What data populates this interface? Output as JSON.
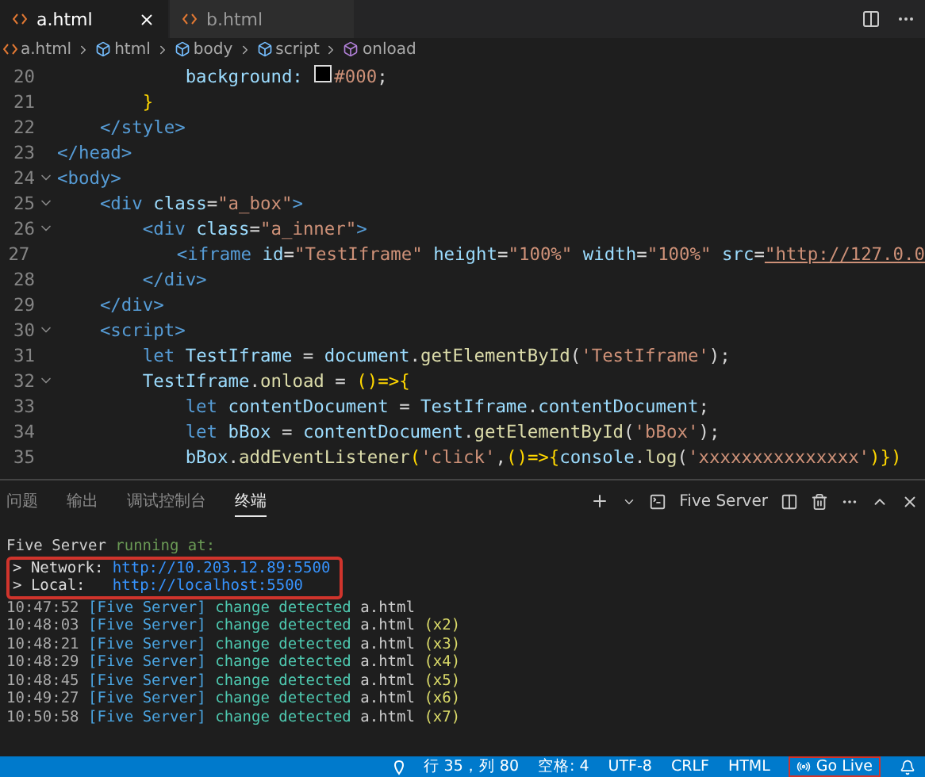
{
  "tabs": [
    {
      "label": "a.html",
      "selected": true
    },
    {
      "label": "b.html",
      "selected": false
    }
  ],
  "breadcrumb": [
    {
      "label": "a.html",
      "kind": "file"
    },
    {
      "label": "html",
      "kind": "element"
    },
    {
      "label": "body",
      "kind": "element"
    },
    {
      "label": "script",
      "kind": "element"
    },
    {
      "label": "onload",
      "kind": "method"
    }
  ],
  "code_lines": [
    {
      "number": "20",
      "foldable": false,
      "tokens": [
        {
          "text": "            background: ",
          "kind": "attr"
        },
        {
          "text": "#000",
          "kind": "swatch"
        },
        {
          "text": ";",
          "kind": "plain"
        }
      ]
    },
    {
      "number": "21",
      "foldable": false,
      "tokens": [
        {
          "text": "        }",
          "kind": "brace"
        }
      ]
    },
    {
      "number": "22",
      "foldable": false,
      "tokens": [
        {
          "text": "    </style>",
          "kind": "tag"
        }
      ]
    },
    {
      "number": "23",
      "foldable": false,
      "tokens": [
        {
          "text": "</head>",
          "kind": "tag"
        }
      ]
    },
    {
      "number": "24",
      "foldable": true,
      "tokens": [
        {
          "text": "<body>",
          "kind": "tag"
        }
      ]
    },
    {
      "number": "25",
      "foldable": true,
      "tokens": [
        {
          "text": "    <div ",
          "kind": "tag"
        },
        {
          "text": "class",
          "kind": "attr"
        },
        {
          "text": "=",
          "kind": "plain"
        },
        {
          "text": "\"a_box\"",
          "kind": "string"
        },
        {
          "text": ">",
          "kind": "tag"
        }
      ]
    },
    {
      "number": "26",
      "foldable": true,
      "tokens": [
        {
          "text": "        <div ",
          "kind": "tag"
        },
        {
          "text": "class",
          "kind": "attr"
        },
        {
          "text": "=",
          "kind": "plain"
        },
        {
          "text": "\"a_inner\"",
          "kind": "string"
        },
        {
          "text": ">",
          "kind": "tag"
        }
      ]
    },
    {
      "number": "27",
      "foldable": false,
      "tokens": [
        {
          "text": "            <iframe ",
          "kind": "tag"
        },
        {
          "text": "id",
          "kind": "attr"
        },
        {
          "text": "=",
          "kind": "plain"
        },
        {
          "text": "\"TestIframe\" ",
          "kind": "string"
        },
        {
          "text": "height",
          "kind": "attr"
        },
        {
          "text": "=",
          "kind": "plain"
        },
        {
          "text": "\"100%\" ",
          "kind": "string"
        },
        {
          "text": "width",
          "kind": "attr"
        },
        {
          "text": "=",
          "kind": "plain"
        },
        {
          "text": "\"100%\" ",
          "kind": "string"
        },
        {
          "text": "src",
          "kind": "attr"
        },
        {
          "text": "=",
          "kind": "plain"
        },
        {
          "text": "\"http://127.0.0",
          "kind": "link"
        }
      ]
    },
    {
      "number": "28",
      "foldable": false,
      "tokens": [
        {
          "text": "        </div>",
          "kind": "tag"
        }
      ]
    },
    {
      "number": "29",
      "foldable": false,
      "tokens": [
        {
          "text": "    </div>",
          "kind": "tag"
        }
      ]
    },
    {
      "number": "30",
      "foldable": true,
      "tokens": [
        {
          "text": "    <script>",
          "kind": "tag"
        }
      ]
    },
    {
      "number": "31",
      "foldable": false,
      "tokens": [
        {
          "text": "        let ",
          "kind": "keyword"
        },
        {
          "text": "TestIframe",
          "kind": "attr"
        },
        {
          "text": " = ",
          "kind": "plain"
        },
        {
          "text": "document",
          "kind": "attr"
        },
        {
          "text": ".",
          "kind": "plain"
        },
        {
          "text": "getElementById",
          "kind": "func"
        },
        {
          "text": "(",
          "kind": "plain"
        },
        {
          "text": "'TestIframe'",
          "kind": "string"
        },
        {
          "text": ");",
          "kind": "plain"
        }
      ]
    },
    {
      "number": "32",
      "foldable": true,
      "tokens": [
        {
          "text": "        TestIframe",
          "kind": "attr"
        },
        {
          "text": ".",
          "kind": "plain"
        },
        {
          "text": "onload",
          "kind": "func"
        },
        {
          "text": " = ",
          "kind": "plain"
        },
        {
          "text": "()=>{",
          "kind": "brace"
        }
      ]
    },
    {
      "number": "33",
      "foldable": false,
      "tokens": [
        {
          "text": "            let ",
          "kind": "keyword"
        },
        {
          "text": "contentDocument",
          "kind": "attr"
        },
        {
          "text": " = ",
          "kind": "plain"
        },
        {
          "text": "TestIframe",
          "kind": "attr"
        },
        {
          "text": ".",
          "kind": "plain"
        },
        {
          "text": "contentDocument",
          "kind": "attr"
        },
        {
          "text": ";",
          "kind": "plain"
        }
      ]
    },
    {
      "number": "34",
      "foldable": false,
      "tokens": [
        {
          "text": "            let ",
          "kind": "keyword"
        },
        {
          "text": "bBox",
          "kind": "attr"
        },
        {
          "text": " = ",
          "kind": "plain"
        },
        {
          "text": "contentDocument",
          "kind": "attr"
        },
        {
          "text": ".",
          "kind": "plain"
        },
        {
          "text": "getElementById",
          "kind": "func"
        },
        {
          "text": "(",
          "kind": "plain"
        },
        {
          "text": "'bBox'",
          "kind": "string"
        },
        {
          "text": ");",
          "kind": "plain"
        }
      ]
    },
    {
      "number": "35",
      "foldable": false,
      "tokens": [
        {
          "text": "            bBox",
          "kind": "attr"
        },
        {
          "text": ".",
          "kind": "plain"
        },
        {
          "text": "addEventListener",
          "kind": "func"
        },
        {
          "text": "(",
          "kind": "brace"
        },
        {
          "text": "'click'",
          "kind": "string"
        },
        {
          "text": ",",
          "kind": "plain"
        },
        {
          "text": "()=>{",
          "kind": "brace"
        },
        {
          "text": "console",
          "kind": "attr"
        },
        {
          "text": ".",
          "kind": "plain"
        },
        {
          "text": "log",
          "kind": "func"
        },
        {
          "text": "(",
          "kind": "plain"
        },
        {
          "text": "'xxxxxxxxxxxxxxx'",
          "kind": "string"
        },
        {
          "text": ")})",
          "kind": "brace"
        }
      ]
    }
  ],
  "panel": {
    "tabs": [
      {
        "label": "问题",
        "selected": false
      },
      {
        "label": "输出",
        "selected": false
      },
      {
        "label": "调试控制台",
        "selected": false
      },
      {
        "label": "终端",
        "selected": true
      }
    ],
    "terminal_name": "Five Server",
    "header": [
      {
        "text": "Five Server ",
        "kind": "plain"
      },
      {
        "text": "running at:",
        "kind": "dim"
      }
    ],
    "addresses": [
      {
        "label": "> Network:",
        "url": "http://10.203.12.89:5500"
      },
      {
        "label": "> Local:",
        "url": "http://localhost:5500"
      }
    ],
    "log": [
      {
        "time": "10:47:52",
        "source": "[Five Server]",
        "message": "change detected",
        "file": "a.html"
      },
      {
        "time": "10:48:03",
        "source": "[Five Server]",
        "message": "change detected",
        "file": "a.html",
        "count": "(x2)"
      },
      {
        "time": "10:48:21",
        "source": "[Five Server]",
        "message": "change detected",
        "file": "a.html",
        "count": "(x3)"
      },
      {
        "time": "10:48:29",
        "source": "[Five Server]",
        "message": "change detected",
        "file": "a.html",
        "count": "(x4)"
      },
      {
        "time": "10:48:45",
        "source": "[Five Server]",
        "message": "change detected",
        "file": "a.html",
        "count": "(x5)"
      },
      {
        "time": "10:49:27",
        "source": "[Five Server]",
        "message": "change detected",
        "file": "a.html",
        "count": "(x6)"
      },
      {
        "time": "10:50:58",
        "source": "[Five Server]",
        "message": "change detected",
        "file": "a.html",
        "count": "(x7)"
      }
    ]
  },
  "status_bar": {
    "items": [
      "行 35，列 80",
      "空格: 4",
      "UTF-8",
      "CRLF",
      "HTML"
    ],
    "go_live": "Go Live"
  }
}
